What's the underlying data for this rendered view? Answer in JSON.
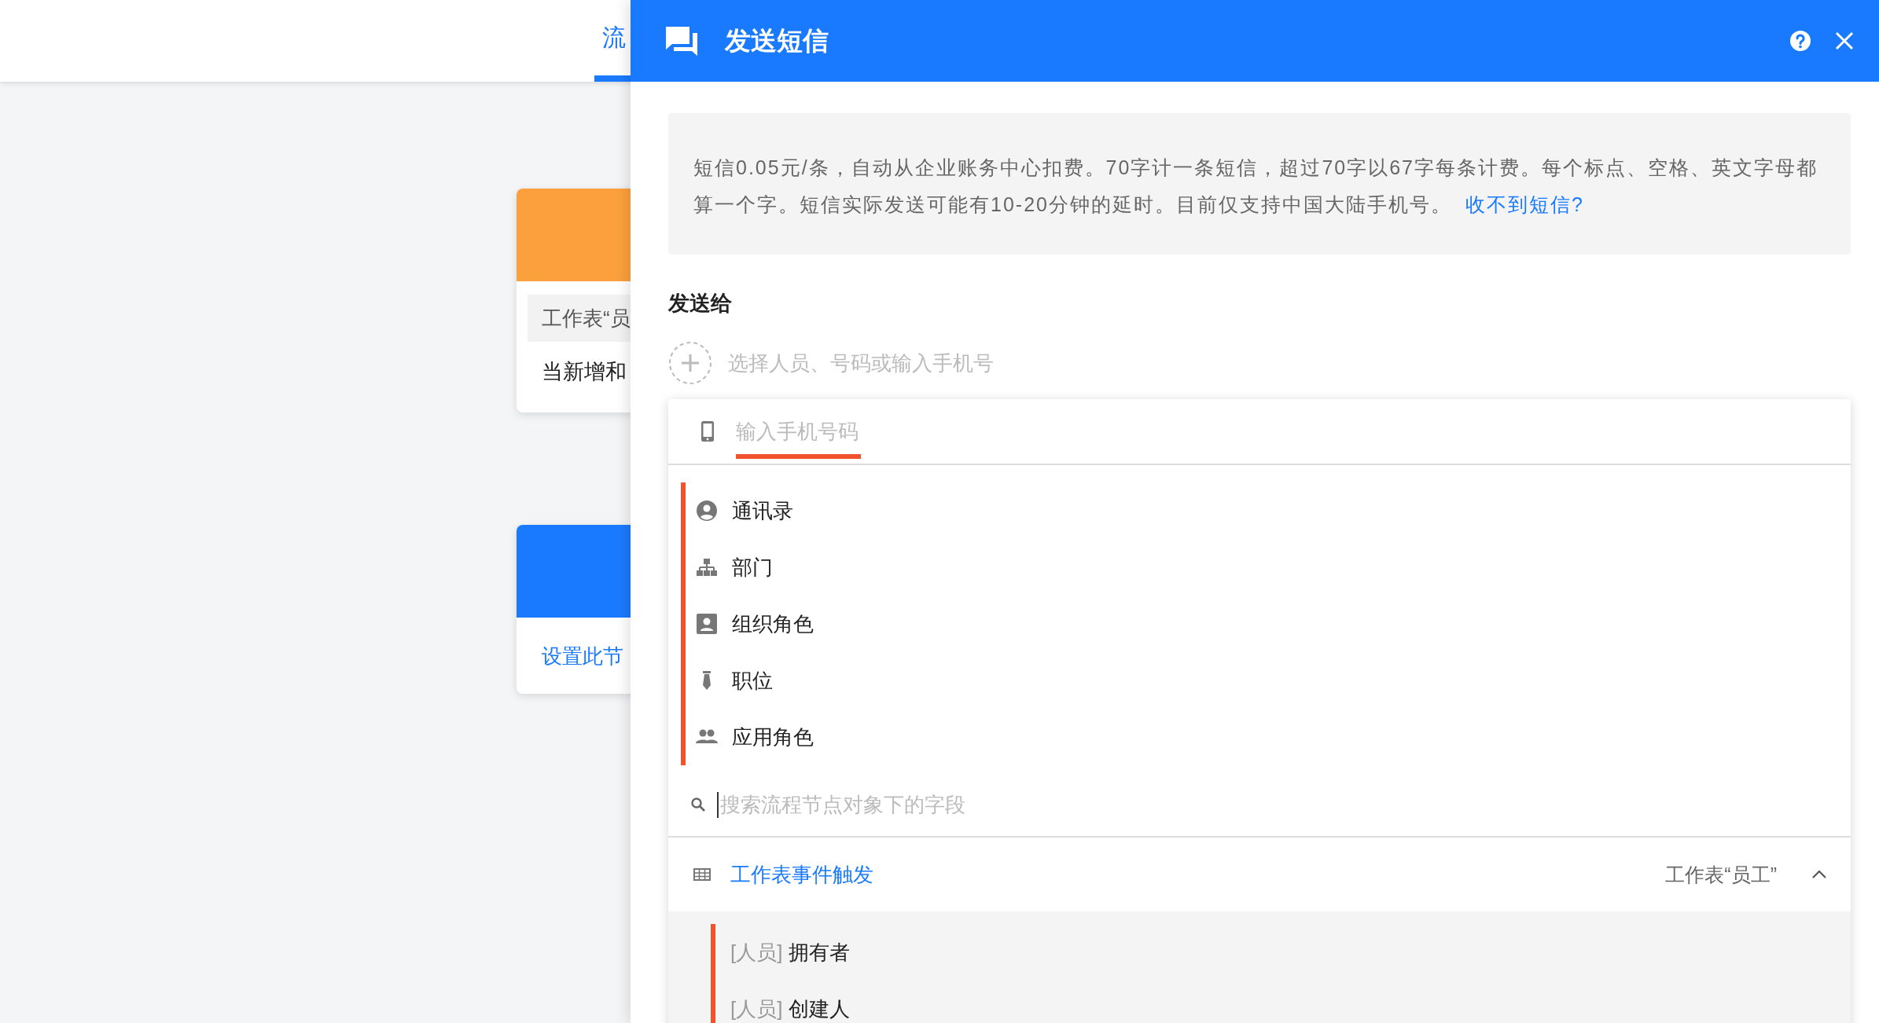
{
  "background": {
    "tab": {
      "label": "流",
      "selected": true
    },
    "cards": [
      {
        "color": "#fba03d",
        "tag": "工作表“员",
        "text": "当新增和"
      },
      {
        "color": "#1a7aff",
        "link": "设置此节"
      }
    ]
  },
  "drawer": {
    "title": "发送短信",
    "notice": {
      "text": "短信0.05元/条，自动从企业账务中心扣费。70字计一条短信，超过70字以67字每条计费。每个标点、空格、英文字母都算一个字。短信实际发送可能有10-20分钟的延时。目前仅支持中国大陆手机号。",
      "link": "收不到短信?"
    },
    "send_to": {
      "label": "发送给",
      "placeholder": "选择人员、号码或输入手机号"
    },
    "dropdown": {
      "phone_placeholder": "输入手机号码",
      "sources": [
        {
          "kind": "contacts",
          "label": "通讯录"
        },
        {
          "kind": "department",
          "label": "部门"
        },
        {
          "kind": "org-role",
          "label": "组织角色"
        },
        {
          "kind": "position",
          "label": "职位"
        },
        {
          "kind": "app-role",
          "label": "应用角色"
        }
      ],
      "field_search_placeholder": "搜索流程节点对象下的字段",
      "groups": [
        {
          "title": "工作表事件触发",
          "subtitle": "工作表“员工”",
          "expanded": true,
          "fields": [
            {
              "type": "[人员]",
              "name": "拥有者"
            },
            {
              "type": "[人员]",
              "name": "创建人"
            }
          ]
        }
      ]
    }
  }
}
